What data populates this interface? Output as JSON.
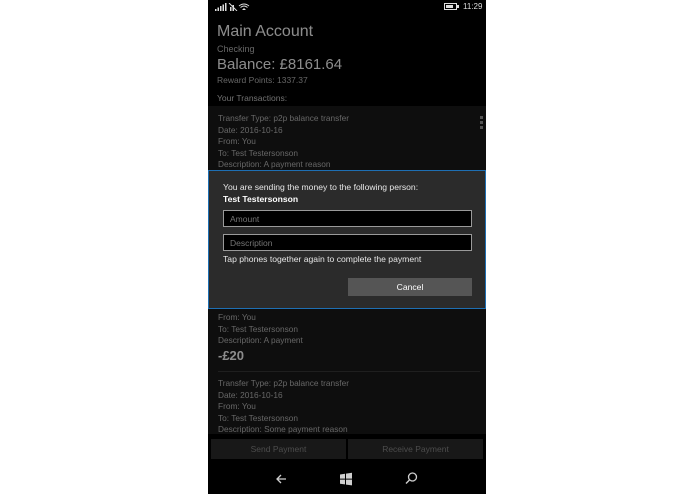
{
  "status_bar": {
    "time": "11:29",
    "battery_level": 0.8
  },
  "account": {
    "title": "Main Account",
    "type": "Checking",
    "balance": "Balance: £8161.64",
    "reward_points": "Reward Points: 1337.37",
    "transactions_heading": "Your Transactions:"
  },
  "transactions": [
    {
      "type": "Transfer Type: p2p balance transfer",
      "date": "Date: 2016-10-16",
      "from": "From: You",
      "to": "To: Test Testersonson",
      "description": "Description: A payment reason"
    },
    {
      "from": "From: You",
      "to": "To: Test Testersonson",
      "description": "Description: A payment",
      "amount": "-£20"
    },
    {
      "type": "Transfer Type: p2p balance transfer",
      "date": "Date: 2016-10-16",
      "from": "From: You",
      "to": "To: Test Testersonson",
      "description": "Description: Some payment reason"
    }
  ],
  "actions": {
    "send_payment": "Send Payment",
    "receive_payment": "Receive Payment"
  },
  "dialog": {
    "message": "You are sending the money to the following person:",
    "recipient": "Test Testersonson",
    "amount_placeholder": "Amount",
    "description_placeholder": "Description",
    "hint": "Tap phones together again to complete the payment",
    "cancel_label": "Cancel"
  },
  "nav": {
    "back_icon": "back-arrow-icon",
    "home_icon": "windows-logo-icon",
    "search_icon": "search-icon"
  },
  "colors": {
    "dialog_border": "#1e6fb3",
    "background": "#000000"
  }
}
